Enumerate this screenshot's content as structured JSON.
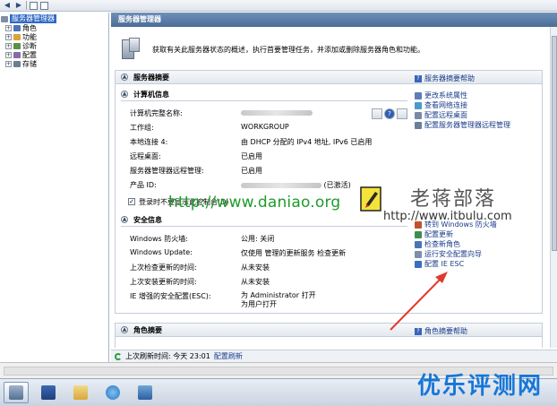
{
  "window": {
    "header_title": "服务器管理器"
  },
  "tree": {
    "root": "服务器管理器",
    "items": [
      {
        "label": "角色",
        "expander": "+"
      },
      {
        "label": "功能",
        "expander": "+"
      },
      {
        "label": "诊断",
        "expander": "+"
      },
      {
        "label": "配置",
        "expander": "+"
      },
      {
        "label": "存储",
        "expander": "+"
      }
    ]
  },
  "intro": {
    "text": "获取有关此服务器状态的概述，执行首要管理任务，并添加或删除服务器角色和功能。"
  },
  "summary": {
    "title": "服务器摘要",
    "help": "服务器摘要帮助",
    "computer": {
      "title": "计算机信息",
      "rows": [
        {
          "k": "计算机完整名称:",
          "v": ""
        },
        {
          "k": "工作组:",
          "v": "WORKGROUP"
        },
        {
          "k": "本地连接 4:",
          "v": "由 DHCP 分配的 IPv4 地址, IPv6 已启用"
        },
        {
          "k": "远程桌面:",
          "v": "已启用"
        },
        {
          "k": "服务器管理器远程管理:",
          "v": "已启用"
        },
        {
          "k": "产品 ID:",
          "v": "(已激活)"
        }
      ],
      "checkbox_label": "登录时不要显示此控制台(D)",
      "checkbox_mark": "✓",
      "tasks": [
        "更改系统属性",
        "查看网络连接",
        "配置远程桌面",
        "配置服务器管理器远程管理"
      ]
    },
    "security": {
      "title": "安全信息",
      "rows": [
        {
          "k": "Windows 防火墙:",
          "v": "公用: 关闭"
        },
        {
          "k": "Windows Update:",
          "v": "仅使用 管理的更新服务 检查更新"
        },
        {
          "k": "上次检查更新的时间:",
          "v": "从未安装"
        },
        {
          "k": "上次安装更新的时间:",
          "v": "从未安装"
        },
        {
          "k": "IE 增强的安全配置(ESC):",
          "v": "为 Administrator 打开",
          "v2": "为用户打开"
        }
      ],
      "tasks": [
        "转到 Windows 防火墙",
        "配置更新",
        "检查新角色",
        "运行安全配置向导",
        "配置 IE ESC"
      ]
    }
  },
  "roles": {
    "title": "角色摘要",
    "help": "角色摘要帮助"
  },
  "status": {
    "last_refresh": "上次刷新时间: 今天 23:01",
    "refresh_link": "配置刷新"
  },
  "watermarks": {
    "url": "http://www.daniao.org",
    "cn": "老蒋部落",
    "cn_url": "http://www.itbulu.com",
    "bottom": "优乐评测网"
  },
  "colors": {
    "link": "#1a3c8a",
    "header": "#4b6d98",
    "selection": "#3169c6",
    "arrow": "#e03a2e"
  }
}
